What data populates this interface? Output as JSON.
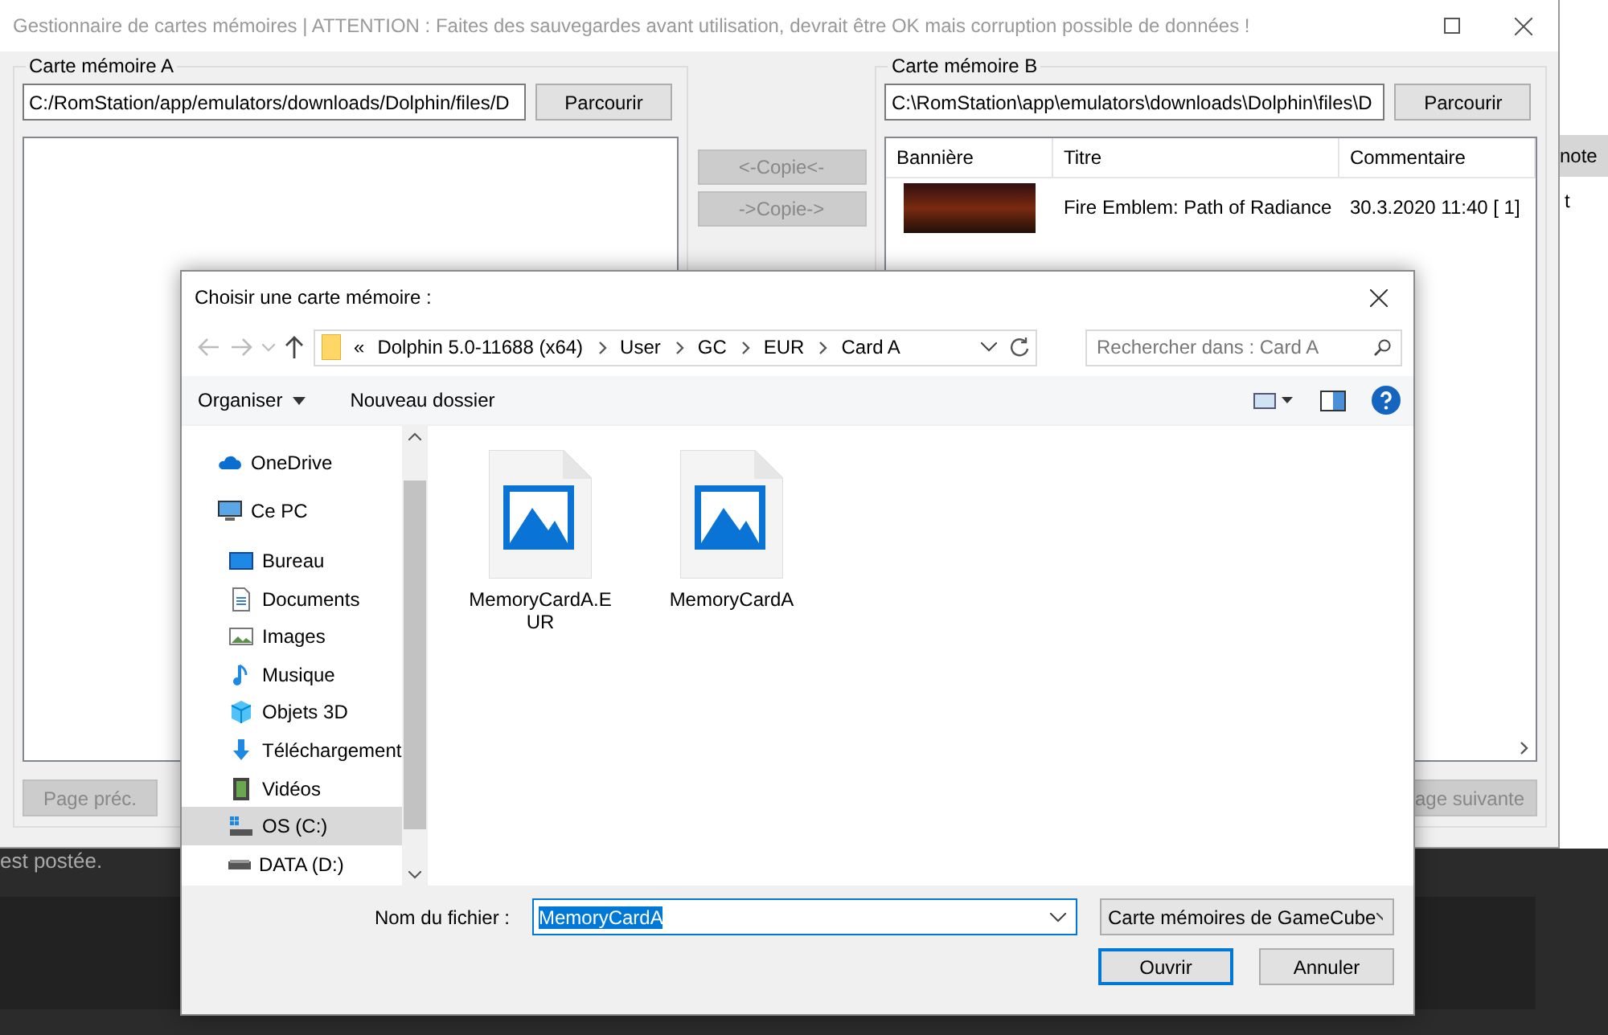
{
  "main_window": {
    "title": "Gestionnaire de cartes mémoires | ATTENTION : Faites des sauvegardes avant utilisation, devrait être OK mais corruption possible de données !",
    "active": false
  },
  "card_a": {
    "legend": "Carte mémoire A",
    "path": "C:/RomStation/app/emulators/downloads/Dolphin/files/D",
    "browse": "Parcourir",
    "prev_page": {
      "label": "Page préc.",
      "disabled": true
    }
  },
  "copy_buttons": [
    {
      "label": "<-Copie<-",
      "disabled": true
    },
    {
      "label": "->Copie->",
      "disabled": true
    }
  ],
  "card_b": {
    "legend": "Carte mémoire B",
    "path": "C:\\RomStation\\app\\emulators\\downloads\\Dolphin\\files\\D",
    "browse": "Parcourir",
    "table": {
      "columns": [
        "Bannière",
        "Titre",
        "Commentaire"
      ],
      "rows": [
        {
          "title": "Fire Emblem: Path of Radiance",
          "comment": "30.3.2020 11:40 [ 1]"
        }
      ]
    },
    "next_page": {
      "label": "age suivante",
      "disabled": true
    }
  },
  "background_page": {
    "column_header": "note",
    "cell": "t",
    "footer_text": "est postée."
  },
  "dialog": {
    "title": "Choisir une carte mémoire :",
    "overflow_marker": "«",
    "breadcrumb": [
      "Dolphin 5.0-11688 (x64)",
      "User",
      "GC",
      "EUR",
      "Card A"
    ],
    "search_placeholder": "Rechercher dans : Card A",
    "toolbar": [
      "Organiser",
      "Nouveau dossier"
    ],
    "nav": [
      {
        "label": "OneDrive",
        "kind": "cloud",
        "selected": false
      },
      {
        "label": "Ce PC",
        "kind": "pc",
        "selected": false,
        "children": [
          {
            "label": "Bureau",
            "kind": "desktop",
            "selected": false
          },
          {
            "label": "Documents",
            "kind": "documents",
            "selected": false
          },
          {
            "label": "Images",
            "kind": "pictures",
            "selected": false
          },
          {
            "label": "Musique",
            "kind": "music",
            "selected": false
          },
          {
            "label": "Objets 3D",
            "kind": "objects3d",
            "selected": false
          },
          {
            "label": "Téléchargement",
            "kind": "downloads",
            "selected": false
          },
          {
            "label": "Vidéos",
            "kind": "videos",
            "selected": false
          },
          {
            "label": "OS (C:)",
            "kind": "system-drive",
            "selected": true
          },
          {
            "label": "DATA (D:)",
            "kind": "drive",
            "selected": false
          }
        ]
      }
    ],
    "files": [
      {
        "name": "MemoryCardA.EUR",
        "selected": false
      },
      {
        "name": "MemoryCardA",
        "selected": false
      }
    ],
    "filename_label": "Nom du fichier :",
    "filename": {
      "value": "MemoryCardA",
      "selected": true
    },
    "filter": "Carte mémoires de GameCube",
    "buttons": [
      {
        "label": "Ouvrir",
        "default": true
      },
      {
        "label": "Annuler",
        "default": false
      }
    ]
  }
}
